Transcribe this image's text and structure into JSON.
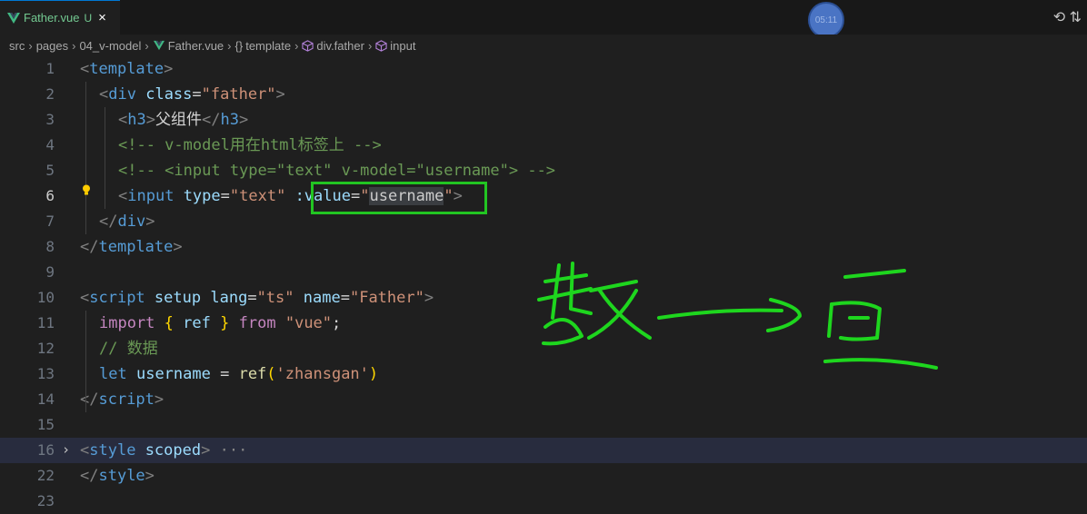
{
  "tab": {
    "filename": "Father.vue",
    "status": "U",
    "close": "×"
  },
  "timer": {
    "text": "05:11"
  },
  "breadcrumb": [
    "src",
    "pages",
    "04_v-model",
    "Father.vue",
    "template",
    "div.father",
    "input"
  ],
  "breadcrumb_icons": [
    "vue-icon",
    "braces-icon",
    "cube-icon",
    "cube-icon"
  ],
  "editor": {
    "line_numbers": [
      "1",
      "2",
      "3",
      "4",
      "5",
      "6",
      "7",
      "8",
      "9",
      "10",
      "11",
      "12",
      "13",
      "14",
      "15",
      "16",
      "22",
      "23"
    ],
    "active_line": "6",
    "highlighted_text": ":value=\"username\"",
    "fold_ellipsis": "···",
    "lines": [
      {
        "tokens": [
          [
            "tagb",
            "<"
          ],
          [
            "tag",
            "template"
          ],
          [
            "tagb",
            ">"
          ]
        ]
      },
      {
        "tokens": [
          [
            "tagb",
            "<"
          ],
          [
            "tag",
            "div"
          ],
          [
            "txt",
            " "
          ],
          [
            "attr",
            "class"
          ],
          [
            "txt",
            "="
          ],
          [
            "str",
            "\"father\""
          ],
          [
            "tagb",
            ">"
          ]
        ]
      },
      {
        "tokens": [
          [
            "tagb",
            "<"
          ],
          [
            "tag",
            "h3"
          ],
          [
            "tagb",
            ">"
          ],
          [
            "txt",
            "父组件"
          ],
          [
            "tagb",
            "</"
          ],
          [
            "tag",
            "h3"
          ],
          [
            "tagb",
            ">"
          ]
        ]
      },
      {
        "tokens": [
          [
            "cm",
            "<!-- v-model用在html标签上 -->"
          ]
        ]
      },
      {
        "tokens": [
          [
            "cm",
            "<!-- <input type=\"text\" v-model=\"username\"> -->"
          ]
        ]
      },
      {
        "tokens": [
          [
            "tagb",
            "<"
          ],
          [
            "tag",
            "input"
          ],
          [
            "txt",
            " "
          ],
          [
            "attr",
            "type"
          ],
          [
            "txt",
            "="
          ],
          [
            "str",
            "\"text\""
          ],
          [
            "txt",
            " "
          ],
          [
            "attr",
            ":value"
          ],
          [
            "txt",
            "="
          ],
          [
            "str",
            "\""
          ],
          [
            "sel",
            "username"
          ],
          [
            "str",
            "\""
          ],
          [
            "tagb",
            ">"
          ]
        ]
      },
      {
        "tokens": [
          [
            "tagb",
            "</"
          ],
          [
            "tag",
            "div"
          ],
          [
            "tagb",
            ">"
          ]
        ]
      },
      {
        "tokens": [
          [
            "tagb",
            "</"
          ],
          [
            "tag",
            "template"
          ],
          [
            "tagb",
            ">"
          ]
        ]
      },
      {
        "tokens": []
      },
      {
        "tokens": [
          [
            "tagb",
            "<"
          ],
          [
            "tag",
            "script"
          ],
          [
            "txt",
            " "
          ],
          [
            "attr",
            "setup"
          ],
          [
            "txt",
            " "
          ],
          [
            "attr",
            "lang"
          ],
          [
            "txt",
            "="
          ],
          [
            "str",
            "\"ts\""
          ],
          [
            "txt",
            " "
          ],
          [
            "attr",
            "name"
          ],
          [
            "txt",
            "="
          ],
          [
            "str",
            "\"Father\""
          ],
          [
            "tagb",
            ">"
          ]
        ]
      },
      {
        "tokens": [
          [
            "kwc",
            "import"
          ],
          [
            "txt",
            " "
          ],
          [
            "br",
            "{"
          ],
          [
            "txt",
            " "
          ],
          [
            "var",
            "ref"
          ],
          [
            "txt",
            " "
          ],
          [
            "br",
            "}"
          ],
          [
            "txt",
            " "
          ],
          [
            "kwc",
            "from"
          ],
          [
            "txt",
            " "
          ],
          [
            "str",
            "\"vue\""
          ],
          [
            "txt",
            ";"
          ]
        ]
      },
      {
        "tokens": [
          [
            "cm",
            "// 数据"
          ]
        ]
      },
      {
        "tokens": [
          [
            "kw",
            "let"
          ],
          [
            "txt",
            " "
          ],
          [
            "var",
            "username"
          ],
          [
            "txt",
            " = "
          ],
          [
            "fn",
            "ref"
          ],
          [
            "br",
            "("
          ],
          [
            "str",
            "'zhansgan'"
          ],
          [
            "br",
            ")"
          ]
        ]
      },
      {
        "tokens": [
          [
            "tagb",
            "</"
          ],
          [
            "tag",
            "script"
          ],
          [
            "tagb",
            ">"
          ]
        ]
      },
      {
        "tokens": []
      },
      {
        "tokens": [
          [
            "tagb",
            "<"
          ],
          [
            "tag",
            "style"
          ],
          [
            "txt",
            " "
          ],
          [
            "attr",
            "scoped"
          ],
          [
            "tagb",
            ">"
          ],
          [
            "ellipsis",
            " ···"
          ]
        ]
      },
      {
        "tokens": [
          [
            "tagb",
            "</"
          ],
          [
            "tag",
            "style"
          ],
          [
            "tagb",
            ">"
          ]
        ]
      },
      {
        "tokens": []
      }
    ]
  },
  "annotation": {
    "description_ink_color": "#1ed61e",
    "box_color": "#22c522"
  }
}
